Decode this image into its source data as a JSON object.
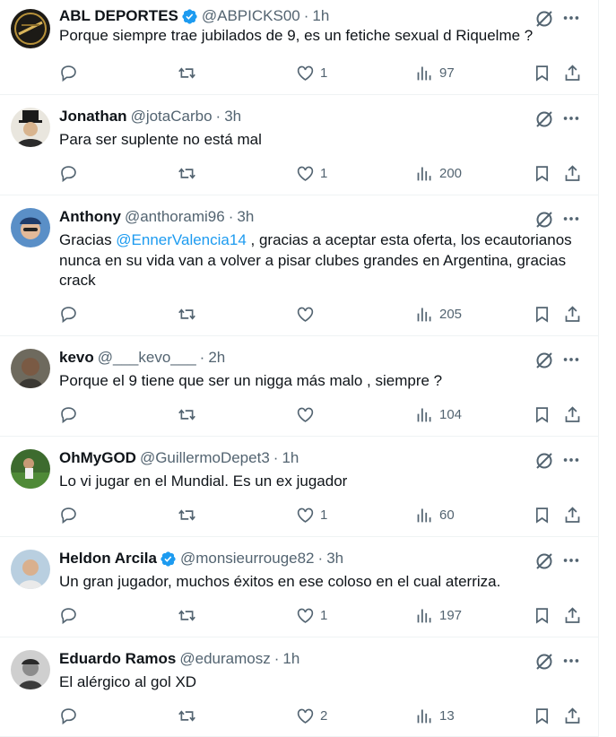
{
  "colors": {
    "text": "#0f1419",
    "muted": "#536471",
    "accent": "#1d9bf0",
    "divider": "#eff3f4"
  },
  "tweets": [
    {
      "name": "ABL DEPORTES",
      "verified": true,
      "handle": "@ABPICKS00",
      "time": "1h",
      "text": "Porque siempre trae jubilados de 9, es un fetiche sexual d Riquelme ?",
      "likes": "1",
      "views": "97"
    },
    {
      "name": "Jonathan",
      "verified": false,
      "handle": "@jotaCarbo",
      "time": "3h",
      "text": "Para ser suplente no está mal",
      "likes": "1",
      "views": "200"
    },
    {
      "name": "Anthony",
      "verified": false,
      "handle": "@anthorami96",
      "time": "3h",
      "text_prefix": "Gracias ",
      "mention": "@EnnerValencia14",
      "text_suffix": " , gracias a aceptar esta oferta, los ecautorianos nunca en su vida van a volver a pisar clubes grandes en Argentina, gracias crack",
      "likes": "",
      "views": "205"
    },
    {
      "name": "kevo",
      "verified": false,
      "handle": "@___kevo___",
      "time": "2h",
      "text": "Porque el 9 tiene que ser un nigga más malo , siempre ?",
      "likes": "",
      "views": "104"
    },
    {
      "name": "OhMyGOD",
      "verified": false,
      "handle": "@GuillermoDepet3",
      "time": "1h",
      "text": "Lo vi jugar en el Mundial. Es un ex jugador",
      "likes": "1",
      "views": "60"
    },
    {
      "name": "Heldon Arcila",
      "verified": true,
      "handle": "@monsieurrouge82",
      "time": "3h",
      "text": "Un gran jugador, muchos éxitos en ese coloso en el cual aterriza.",
      "likes": "1",
      "views": "197"
    },
    {
      "name": "Eduardo Ramos",
      "verified": false,
      "handle": "@eduramosz",
      "time": "1h",
      "text": "El alérgico al gol XD",
      "likes": "2",
      "views": "13"
    }
  ],
  "separator": "·",
  "icons": [
    "verified-badge-icon",
    "grok-icon",
    "more-icon",
    "reply-icon",
    "retweet-icon",
    "like-icon",
    "views-icon",
    "bookmark-icon",
    "share-icon"
  ]
}
